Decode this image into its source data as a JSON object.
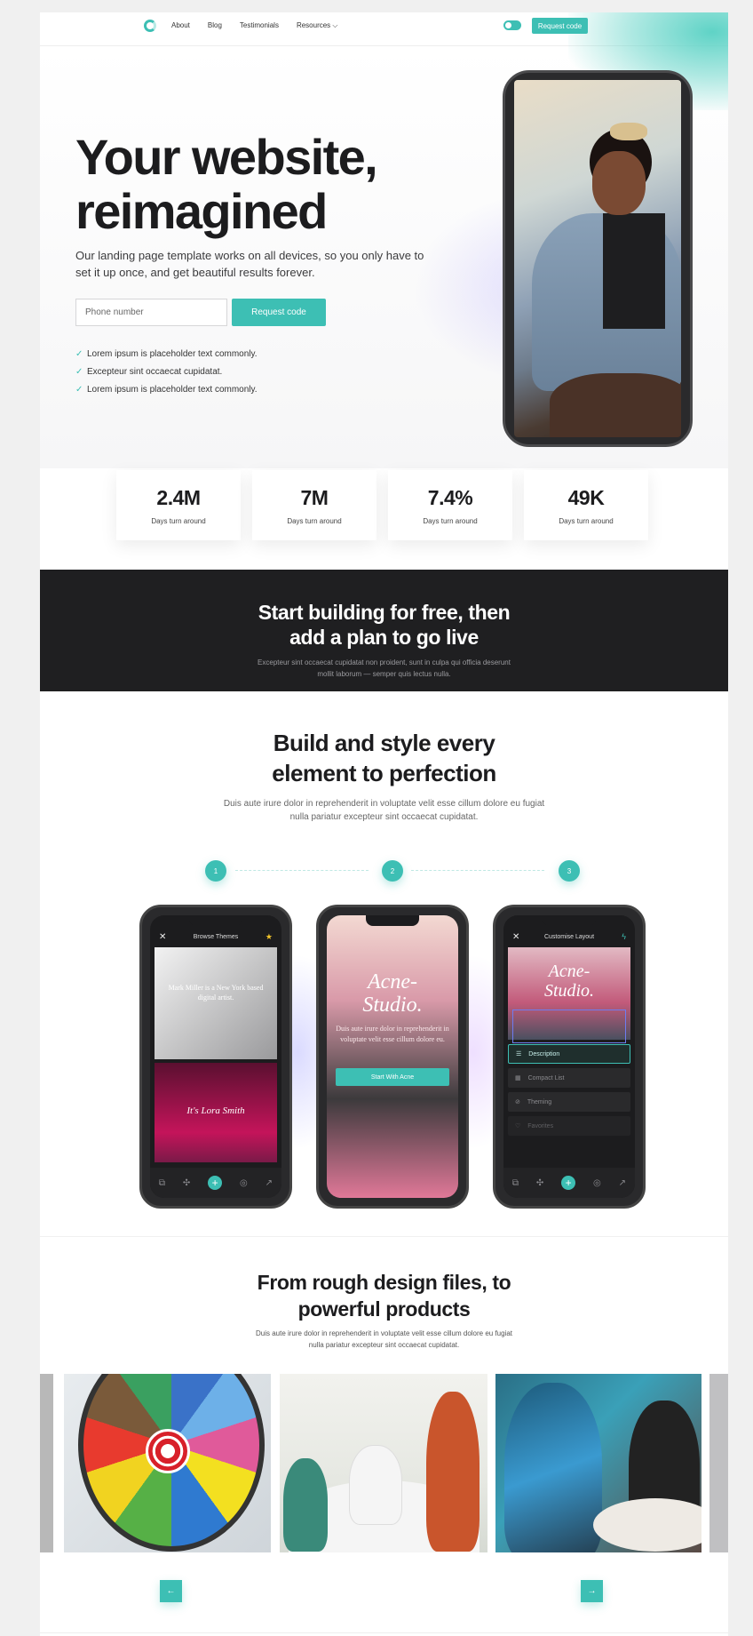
{
  "nav": {
    "links": [
      "About",
      "Blog",
      "Testimonials",
      "Resources ⌵"
    ],
    "cta": "Request code"
  },
  "hero": {
    "title_line1": "Your website,",
    "title_line2": "reimagined",
    "subtitle": "Our landing page template works on all devices, so you only have to set it up once, and get beautiful results forever.",
    "input_placeholder": "Phone number",
    "cta": "Request code",
    "checks": [
      "Lorem ipsum is placeholder text commonly.",
      "Excepteur sint occaecat cupidatat.",
      "Lorem ipsum is placeholder text commonly."
    ]
  },
  "stats": [
    {
      "value": "2.4M",
      "label": "Days turn around"
    },
    {
      "value": "7M",
      "label": "Days turn around"
    },
    {
      "value": "7.4%",
      "label": "Days turn around"
    },
    {
      "value": "49K",
      "label": "Days turn around"
    }
  ],
  "dark_band": {
    "title_line1": "Start building for free, then",
    "title_line2": "add a plan to go live",
    "sub_line1": "Excepteur sint occaecat cupidatat non proident, sunt in culpa qui officia deserunt",
    "sub_line2": "mollit laborum — semper quis lectus nulla."
  },
  "build": {
    "title_line1": "Build and style every",
    "title_line2": "element to perfection",
    "sub_line1": "Duis aute irure dolor in reprehenderit in voluptate velit esse cillum dolore eu fugiat",
    "sub_line2": "nulla pariatur excepteur sint occaecat cupidatat.",
    "steps": [
      "1",
      "2",
      "3"
    ]
  },
  "phones": {
    "p1": {
      "bar_title": "Browse Themes",
      "close": "✕",
      "star": "★",
      "photo_text": "Mark Miller is a New York based digital artist.",
      "script": "It's Lora Smith"
    },
    "p2": {
      "title_line1": "Acne-",
      "title_line2": "Studio.",
      "text": "Duis aute irure dolor in reprehenderit in voluptate velit esse cillum dolore eu.",
      "button": "Start With Acne"
    },
    "p3": {
      "bar_title": "Customise Layout",
      "close": "✕",
      "title_line1": "Acne-",
      "title_line2": "Studio.",
      "items": [
        "Description",
        "Compact List",
        "Theming",
        "Favorites"
      ]
    },
    "tab_icons": [
      "⧉",
      "✣",
      "+",
      "◎",
      "↗"
    ]
  },
  "rough": {
    "title_line1": "From rough design files, to",
    "title_line2": "powerful products",
    "sub_line1": "Duis aute irure dolor in reprehenderit in voluptate velit esse cillum dolore eu fugiat",
    "sub_line2": "nulla pariatur excepteur sint occaecat cupidatat."
  },
  "arrows": {
    "prev": "←",
    "next": "→"
  },
  "colors": {
    "accent": "#3dbfb4",
    "dark": "#1f1f21",
    "text": "#1c1c1e"
  }
}
